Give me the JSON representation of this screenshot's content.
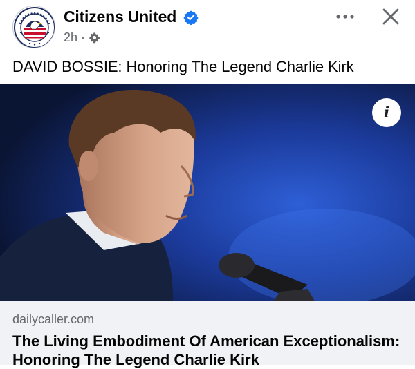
{
  "post": {
    "page_name": "Citizens United",
    "time": "2h",
    "separator": "·",
    "text": "DAVID BOSSIE: Honoring The Legend Charlie Kirk",
    "avatar_text": "CITIZENS UNITED"
  },
  "icons": {
    "verified": "verified-badge-icon",
    "audience": "gear-icon",
    "more": "more-options-icon",
    "close": "close-icon",
    "info": "info-icon"
  },
  "info_button": {
    "label": "i"
  },
  "link": {
    "domain": "dailycaller.com",
    "headline": "The Living Embodiment Of American Exceptionalism: Honoring The Legend Charlie Kirk"
  },
  "colors": {
    "verified_blue": "#1877f2",
    "meta_gray": "#65676b",
    "card_bg": "#f0f2f5"
  }
}
